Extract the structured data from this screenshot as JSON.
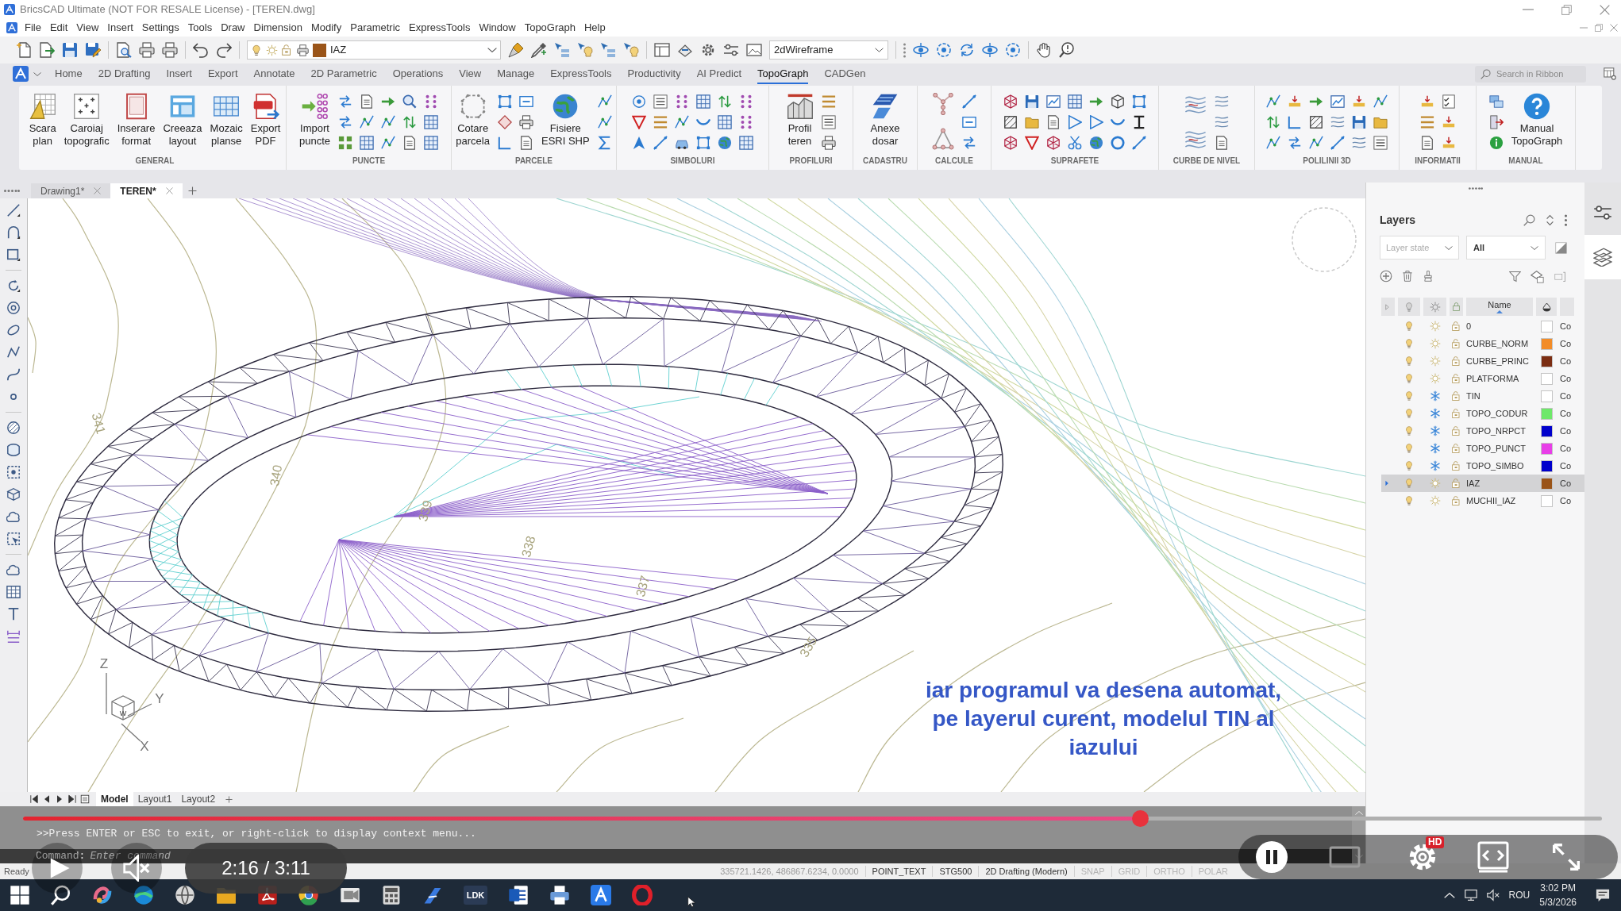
{
  "window": {
    "title": "BricsCAD Ultimate (NOT FOR RESALE License) - [TEREN.dwg]"
  },
  "menu": [
    "File",
    "Edit",
    "View",
    "Insert",
    "Settings",
    "Tools",
    "Draw",
    "Dimension",
    "Modify",
    "Parametric",
    "ExpressTools",
    "Window",
    "TopoGraph",
    "Help"
  ],
  "toolbar": {
    "layer_dropdown": {
      "value": "IAZ",
      "color": "#9a5418"
    },
    "visual_style": {
      "value": "2dWireframe"
    }
  },
  "ribbon_tabs": [
    {
      "label": "Home",
      "selected": false
    },
    {
      "label": "2D Drafting",
      "selected": false
    },
    {
      "label": "Insert",
      "selected": false
    },
    {
      "label": "Export",
      "selected": false
    },
    {
      "label": "Annotate",
      "selected": false
    },
    {
      "label": "2D Parametric",
      "selected": false
    },
    {
      "label": "Operations",
      "selected": false
    },
    {
      "label": "View",
      "selected": false
    },
    {
      "label": "Manage",
      "selected": false
    },
    {
      "label": "ExpressTools",
      "selected": false
    },
    {
      "label": "Productivity",
      "selected": false
    },
    {
      "label": "AI Predict",
      "selected": false
    },
    {
      "label": "TopoGraph",
      "selected": true
    },
    {
      "label": "CADGen",
      "selected": false
    }
  ],
  "ribbon_search": {
    "placeholder": "Search in Ribbon"
  },
  "ribbon_groups": [
    {
      "label": "GENERAL",
      "buttons": [
        "Scara\nplan",
        "Caroiaj\ntopografic",
        "Inserare\nformat",
        "Creeaza\nlayout",
        "Mozaic\nplanse",
        "Export\nPDF"
      ]
    },
    {
      "label": "PUNCTE",
      "buttons": [
        "Import\npuncte"
      ]
    },
    {
      "label": "PARCELE",
      "buttons": [
        "Cotare\nparcela",
        "Fisiere\nESRI SHP"
      ]
    },
    {
      "label": "SIMBOLURI"
    },
    {
      "label": "PROFILURI",
      "buttons": [
        "Profil\nteren"
      ]
    },
    {
      "label": "CADASTRU",
      "buttons": [
        "Anexe\ndosar"
      ]
    },
    {
      "label": "CALCULE"
    },
    {
      "label": "SUPRAFETE"
    },
    {
      "label": "CURBE DE NIVEL"
    },
    {
      "label": "POLILINII 3D"
    },
    {
      "label": "INFORMATII"
    },
    {
      "label": "MANUAL",
      "buttons": [
        "Manual\nTopoGraph"
      ]
    }
  ],
  "document_tabs": [
    {
      "label": "Drawing1*",
      "selected": false
    },
    {
      "label": "TEREN*",
      "selected": true
    }
  ],
  "drawing": {
    "contour_labels": [
      "341",
      "340",
      "339",
      "338",
      "337",
      "335"
    ],
    "axis_labels": [
      "Z",
      "Y",
      "X"
    ],
    "cube_label": "W"
  },
  "caption": "iar programul va desena automat,\npe layerul curent, modelul TIN al\niazului",
  "layout_tabs": [
    {
      "label": "Model",
      "selected": true
    },
    {
      "label": "Layout1",
      "selected": false
    },
    {
      "label": "Layout2",
      "selected": false
    }
  ],
  "command_line": {
    "history": [
      ">>Press ENTER or ESC to exit, or right-click to display context menu..."
    ],
    "prompt": "Command:",
    "placeholder": "Enter command"
  },
  "layers_panel": {
    "title": "Layers",
    "layer_state": {
      "placeholder": "Layer state"
    },
    "filter": {
      "value": "All"
    },
    "columns": [
      "Name"
    ],
    "rows": [
      {
        "name": "0",
        "on": true,
        "frozen": false,
        "locked": false,
        "color": "#ffffff",
        "column_7": "Co",
        "selected": false
      },
      {
        "name": "CURBE_NORM",
        "on": true,
        "frozen": false,
        "locked": false,
        "color": "#f28c28",
        "column_7": "Co",
        "selected": false
      },
      {
        "name": "CURBE_PRINC",
        "on": true,
        "frozen": false,
        "locked": false,
        "color": "#7b2d12",
        "column_7": "Co",
        "selected": false
      },
      {
        "name": "PLATFORMA",
        "on": true,
        "frozen": false,
        "locked": false,
        "color": "#ffffff",
        "column_7": "Co",
        "selected": false
      },
      {
        "name": "TIN",
        "on": true,
        "frozen": true,
        "locked": false,
        "color": "#ffffff",
        "column_7": "Co",
        "selected": false
      },
      {
        "name": "TOPO_CODUR",
        "on": true,
        "frozen": true,
        "locked": false,
        "color": "#6ee86a",
        "column_7": "Co",
        "selected": false
      },
      {
        "name": "TOPO_NRPCT",
        "on": true,
        "frozen": true,
        "locked": false,
        "color": "#0000cc",
        "column_7": "Co",
        "selected": false
      },
      {
        "name": "TOPO_PUNCT",
        "on": true,
        "frozen": true,
        "locked": false,
        "color": "#e83ee8",
        "column_7": "Co",
        "selected": false
      },
      {
        "name": "TOPO_SIMBO",
        "on": true,
        "frozen": true,
        "locked": false,
        "color": "#0000cc",
        "column_7": "Co",
        "selected": false
      },
      {
        "name": "IAZ",
        "on": true,
        "frozen": false,
        "locked": false,
        "color": "#9a5418",
        "column_7": "Co",
        "selected": true
      },
      {
        "name": "MUCHII_IAZ",
        "on": true,
        "frozen": false,
        "locked": false,
        "color": "#ffffff",
        "column_7": "Co",
        "selected": false
      }
    ]
  },
  "side_tabs": [
    {
      "selected": false
    },
    {
      "selected": true
    }
  ],
  "status_bar": {
    "state": "Ready",
    "coordinates": "335721.1426, 486867.6234, 0.0000",
    "items": [
      {
        "label": "POINT_TEXT",
        "kind": "field"
      },
      {
        "label": "STG500",
        "kind": "field"
      },
      {
        "label": "2D Drafting (Modern)",
        "kind": "field"
      },
      {
        "label": "SNAP",
        "kind": "toggle",
        "on": false
      },
      {
        "label": "GRID",
        "kind": "toggle",
        "on": false
      },
      {
        "label": "ORTHO",
        "kind": "toggle",
        "on": false
      },
      {
        "label": "POLAR",
        "kind": "toggle",
        "on": false
      }
    ]
  },
  "video_player": {
    "progress": {
      "level": 0.71
    },
    "time": "2:16 / 3:11",
    "quality_badge": "HD"
  },
  "taskbar": {
    "app_label": "LDK",
    "language": "ROU",
    "time": "3:02 PM",
    "date": "5/3/2026"
  }
}
